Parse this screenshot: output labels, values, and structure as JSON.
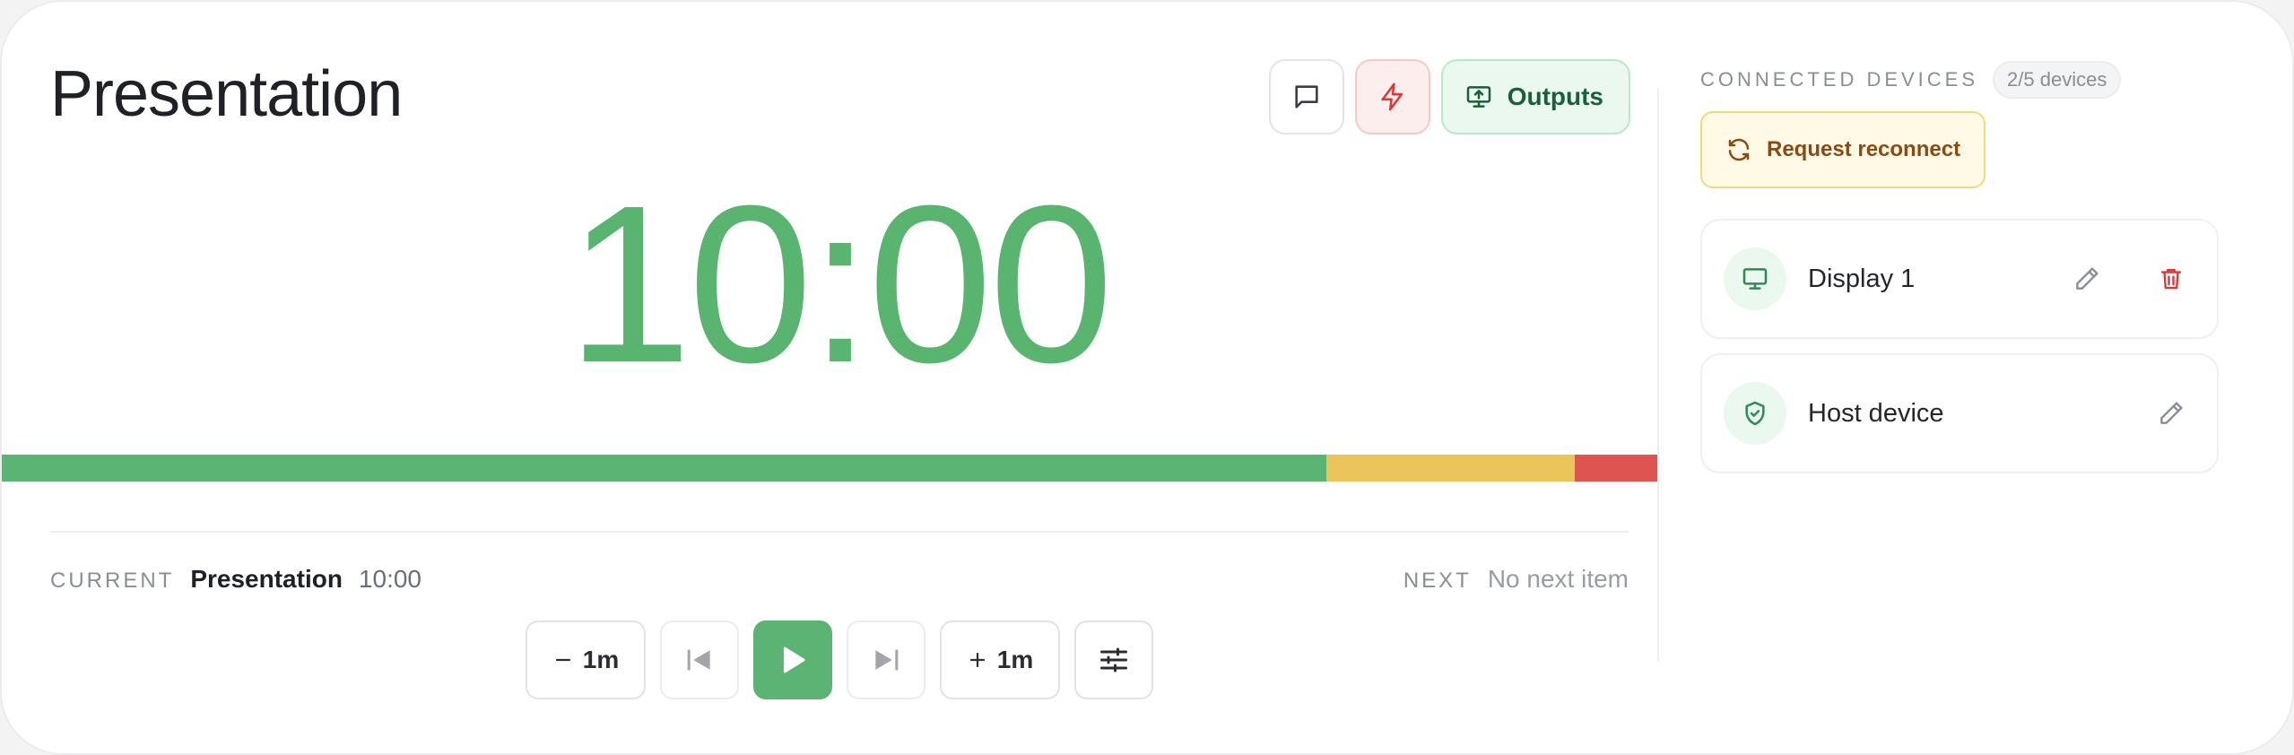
{
  "header": {
    "title": "Presentation"
  },
  "toolbar": {
    "outputs_label": "Outputs"
  },
  "timer": {
    "display": "10:00"
  },
  "progress": {
    "green": 0.8,
    "yellow": 0.15,
    "red": 0.05,
    "colors": {
      "green": "#5bb473",
      "yellow": "#ecc55a",
      "red": "#de5450"
    }
  },
  "current": {
    "label": "CURRENT",
    "name": "Presentation",
    "duration": "10:00"
  },
  "next": {
    "label": "NEXT",
    "value": "No next item"
  },
  "controls": {
    "minus_label": "1m",
    "plus_label": "1m"
  },
  "side": {
    "title": "CONNECTED DEVICES",
    "count": "2/5 devices",
    "reconnect_label": "Request reconnect",
    "devices": [
      {
        "name": "Display 1",
        "icon": "monitor-icon"
      },
      {
        "name": "Host device",
        "icon": "shield-check-icon"
      }
    ]
  },
  "icons": {
    "message": "message-icon",
    "flash": "lightning-icon",
    "outputs": "screen-share-icon",
    "minus": "minus-icon",
    "plus": "plus-icon",
    "prev": "skip-previous-icon",
    "play": "play-icon",
    "next": "skip-next-icon",
    "settings": "sliders-icon",
    "refresh": "refresh-icon",
    "edit": "pencil-icon",
    "delete": "trash-icon"
  },
  "accent": {
    "green": "#59b470",
    "red": "#d63b3b",
    "amber": "#8a4b12"
  }
}
